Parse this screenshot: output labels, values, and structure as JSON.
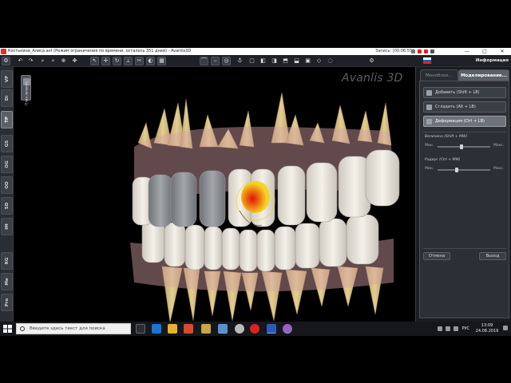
{
  "window": {
    "title": "Костькина_Алиса.avt (Режим ограничения по времени, осталось 351 дней) - Avantis3D",
    "controls": [
      "—",
      "□",
      "✕"
    ],
    "recording_label": "Запись: [00:06:55]"
  },
  "toolbar": {
    "info_label": "Информация",
    "flag_colors": [
      "#ffffff",
      "#1c57c6",
      "#d52b1e"
    ]
  },
  "left_tabs": [
    "VP",
    "Di",
    "TP",
    "GS",
    "OG",
    "OD",
    "SD",
    "IM",
    "RG",
    "Me",
    "Pro"
  ],
  "active_left_tab": "TP",
  "plan_panel": {
    "label": "План лечения"
  },
  "logo": "Avanlis 3D",
  "right_panel": {
    "tabs": [
      "Моноблок...",
      "Моделирование..."
    ],
    "active_tab": "Моделирование...",
    "buttons": [
      {
        "label": "Добавить (Shift + LB)",
        "active": false,
        "icon": "add-icon"
      },
      {
        "label": "Сгладить (Alt + LB)",
        "active": false,
        "icon": "smooth-icon"
      },
      {
        "label": "Деформация (Ctrl + LB)",
        "active": true,
        "icon": "deform-icon"
      }
    ],
    "sliders": [
      {
        "title": "Величина (Shift + MW)",
        "min_label": "Мин.",
        "max_label": "Макс.",
        "value": 0.45
      },
      {
        "title": "Радиус (Ctrl + MW)",
        "min_label": "Мин.",
        "max_label": "Макс.",
        "value": 0.35
      }
    ],
    "cancel_label": "Отмена",
    "exit_label": "Выход"
  },
  "taskbar": {
    "search_placeholder": "Введите здесь текст для поиска",
    "language": "РУС",
    "time": "13:09",
    "date": "24.08.2019",
    "apps": [
      "task-view-icon",
      "edge-icon",
      "explorer-icon",
      "store-icon",
      "mail-icon",
      "chrome-icon",
      "yandex-icon",
      "word-icon",
      "screen-recorder-icon",
      "avantis-icon"
    ]
  },
  "colors": {
    "accent_active": "#6d727b",
    "tooth": "#e8e4dc",
    "root": "#d8c28a",
    "gum": "#d7a2a8",
    "crown_gray": "#8c8f93",
    "heat_red": "#e01010",
    "heat_yellow": "#f3d21f"
  }
}
